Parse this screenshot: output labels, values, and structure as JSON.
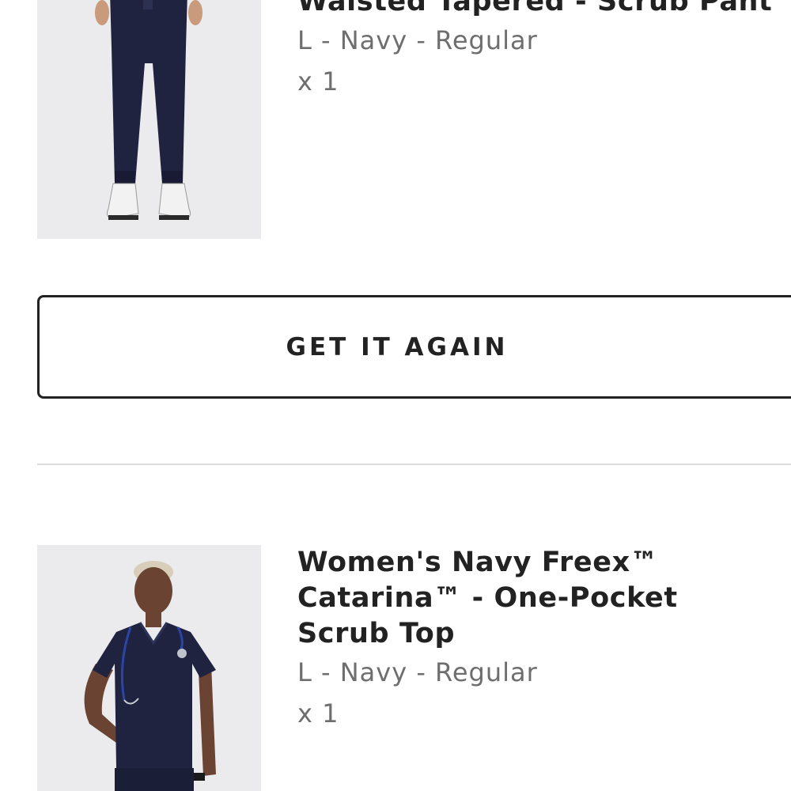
{
  "order_items": [
    {
      "title": "Waisted Tapered - Scrub Pant",
      "variant": "L - Navy - Regular",
      "quantity": "x 1",
      "image_icon": "scrub-pant-photo"
    },
    {
      "title": "Women's Navy Freex™ Catarina™ - One-Pocket Scrub Top",
      "variant": "L - Navy - Regular",
      "quantity": "x 1",
      "image_icon": "scrub-top-photo"
    }
  ],
  "actions": {
    "get_it_again_label": "GET IT AGAIN"
  },
  "colors": {
    "text_primary": "#222222",
    "text_secondary": "#6e6e6e",
    "divider": "#dcdcdc",
    "navy": "#1f2340"
  }
}
